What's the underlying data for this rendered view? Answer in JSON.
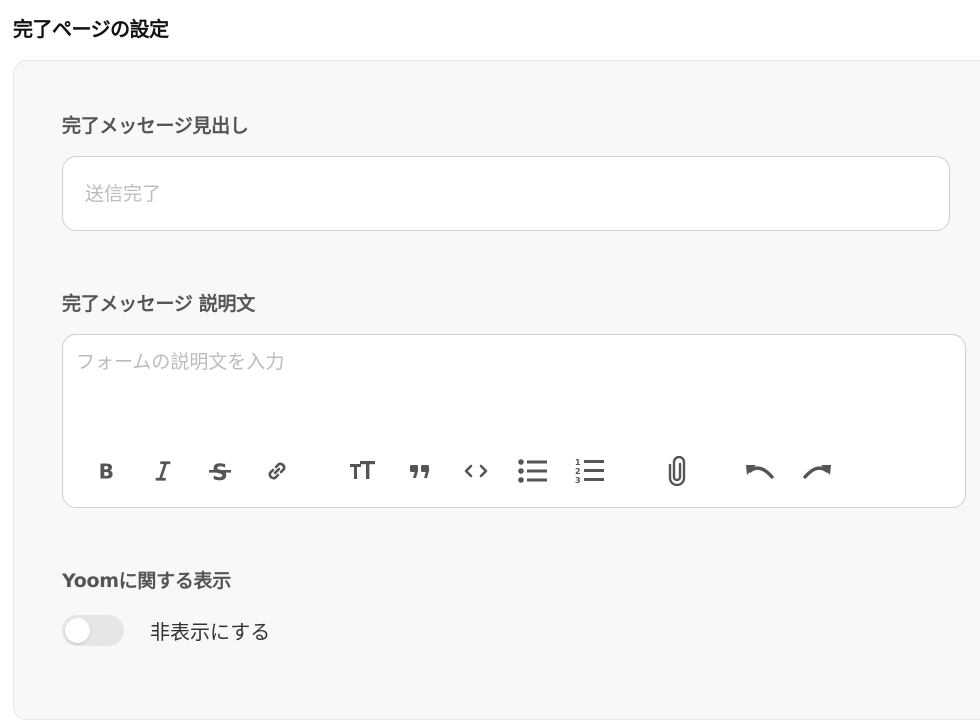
{
  "page_title": "完了ページの設定",
  "headline": {
    "label": "完了メッセージ見出し",
    "placeholder": "送信完了",
    "value": ""
  },
  "description": {
    "label": "完了メッセージ 説明文",
    "placeholder": "フォームの説明文を入力",
    "value": "",
    "toolbar": [
      "bold-icon",
      "italic-icon",
      "strikethrough-icon",
      "link-icon",
      "text-size-icon",
      "quote-icon",
      "code-icon",
      "bullet-list-icon",
      "numbered-list-icon",
      "attachment-icon",
      "undo-icon",
      "redo-icon"
    ]
  },
  "yoom_display": {
    "label": "Yoomに関する表示",
    "toggle_label": "非表示にする",
    "toggle_on": false
  },
  "colors": {
    "icon": "#555555",
    "label": "#555555",
    "panel_bg": "#f8f8f8",
    "placeholder": "#bcbcbc"
  }
}
